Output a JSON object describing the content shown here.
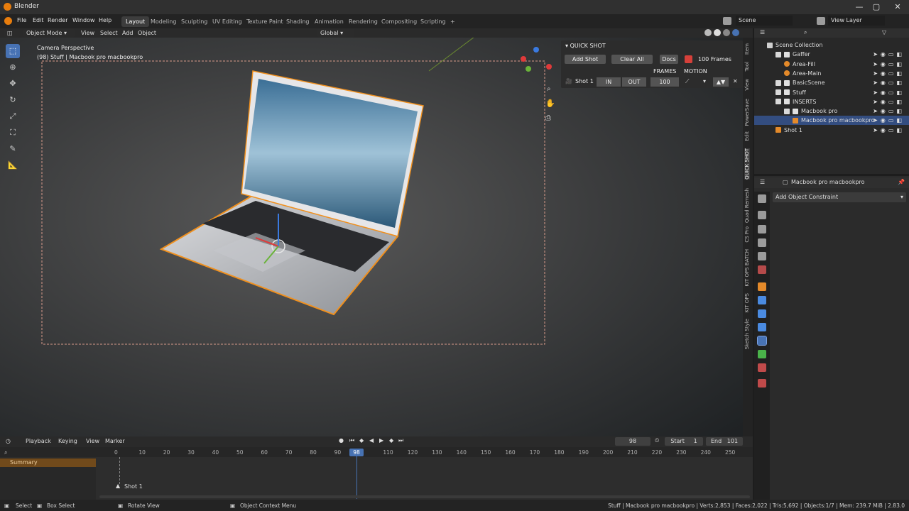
{
  "app": {
    "title": "Blender"
  },
  "window_controls": {
    "minimize": "—",
    "maximize": "▢",
    "close": "✕"
  },
  "menus": [
    "File",
    "Edit",
    "Render",
    "Window",
    "Help"
  ],
  "workspaces": [
    "Layout",
    "Modeling",
    "Sculpting",
    "UV Editing",
    "Texture Paint",
    "Shading",
    "Animation",
    "Rendering",
    "Compositing",
    "Scripting"
  ],
  "add_workspace": "+",
  "scene": {
    "name": "Scene",
    "view_layer": "View Layer"
  },
  "viewport_header": {
    "mode": "Object Mode",
    "view": "View",
    "select": "Select",
    "add": "Add",
    "object": "Object",
    "transform": "Global"
  },
  "viewport": {
    "camera_title": "Camera Perspective",
    "object_line": "(98) Stuff | Macbook pro macbookpro"
  },
  "quick_shot": {
    "title": "QUICK SHOT",
    "add_shot": "Add Shot",
    "clear_all": "Clear All",
    "docs": "Docs",
    "frames_count": "100 Frames",
    "frames_label": "FRAMES",
    "motion_label": "MOTION",
    "shot_name": "Shot 1",
    "in": "IN",
    "out": "OUT",
    "frames_value": "100"
  },
  "side_tabs": [
    "Item",
    "Tool",
    "View",
    "PowerSave",
    "Edit",
    "QUICK SHOT",
    "Quad Remesh",
    "CS Pro",
    "KIT OPS BATCH",
    "KIT OPS",
    "Sketch Style"
  ],
  "outliner": {
    "rows": [
      {
        "label": "Scene Collection",
        "indent": 0,
        "icon": "scene-collection-icon",
        "check": false,
        "selected": false,
        "vis": false
      },
      {
        "label": "Gaffer",
        "indent": 1,
        "icon": "collection-icon",
        "check": true,
        "selected": false,
        "vis": true
      },
      {
        "label": "Area-Fill",
        "indent": 2,
        "icon": "light-icon",
        "check": false,
        "selected": false,
        "vis": true
      },
      {
        "label": "Area-Main",
        "indent": 2,
        "icon": "light-icon",
        "check": false,
        "selected": false,
        "vis": true
      },
      {
        "label": "BasicScene",
        "indent": 1,
        "icon": "collection-icon",
        "check": true,
        "selected": false,
        "vis": true
      },
      {
        "label": "Stuff",
        "indent": 1,
        "icon": "collection-icon",
        "check": true,
        "selected": false,
        "vis": true
      },
      {
        "label": "INSERTS",
        "indent": 1,
        "icon": "collection-icon",
        "check": true,
        "selected": false,
        "vis": true
      },
      {
        "label": "Macbook pro",
        "indent": 2,
        "icon": "collection-icon",
        "check": true,
        "selected": false,
        "vis": true
      },
      {
        "label": "Macbook pro macbookpro",
        "indent": 3,
        "icon": "mesh-icon",
        "check": false,
        "selected": true,
        "vis": true
      },
      {
        "label": "Shot 1",
        "indent": 1,
        "icon": "camera-icon",
        "check": false,
        "selected": false,
        "vis": true
      }
    ]
  },
  "properties": {
    "object_name": "Macbook pro macbookpro",
    "add_constraint": "Add Object Constraint"
  },
  "timeline": {
    "playback": "Playback",
    "keying": "Keying",
    "view": "View",
    "marker": "Marker",
    "current_frame": "98",
    "start_label": "Start",
    "start": "1",
    "end_label": "End",
    "end": "101",
    "ticks": [
      "0",
      "10",
      "20",
      "30",
      "40",
      "50",
      "60",
      "70",
      "80",
      "90",
      "110",
      "120",
      "130",
      "140",
      "150",
      "160",
      "170",
      "180",
      "190",
      "200",
      "210",
      "220",
      "230",
      "240",
      "250"
    ],
    "playhead": "98",
    "summary": "Summary",
    "marker_label": "Shot 1"
  },
  "status_bar": {
    "select": "Select",
    "box_select": "Box Select",
    "rotate": "Rotate View",
    "context": "Object Context Menu",
    "stats": "Stuff | Macbook pro macbookpro | Verts:2,853 | Faces:2,022 | Tris:5,692 | Objects:1/7 | Mem: 239.7 MiB | 2.83.0"
  },
  "colors": {
    "accent": "#4772b3",
    "selection_orange": "#f0901e",
    "summary": "#714a1b"
  }
}
